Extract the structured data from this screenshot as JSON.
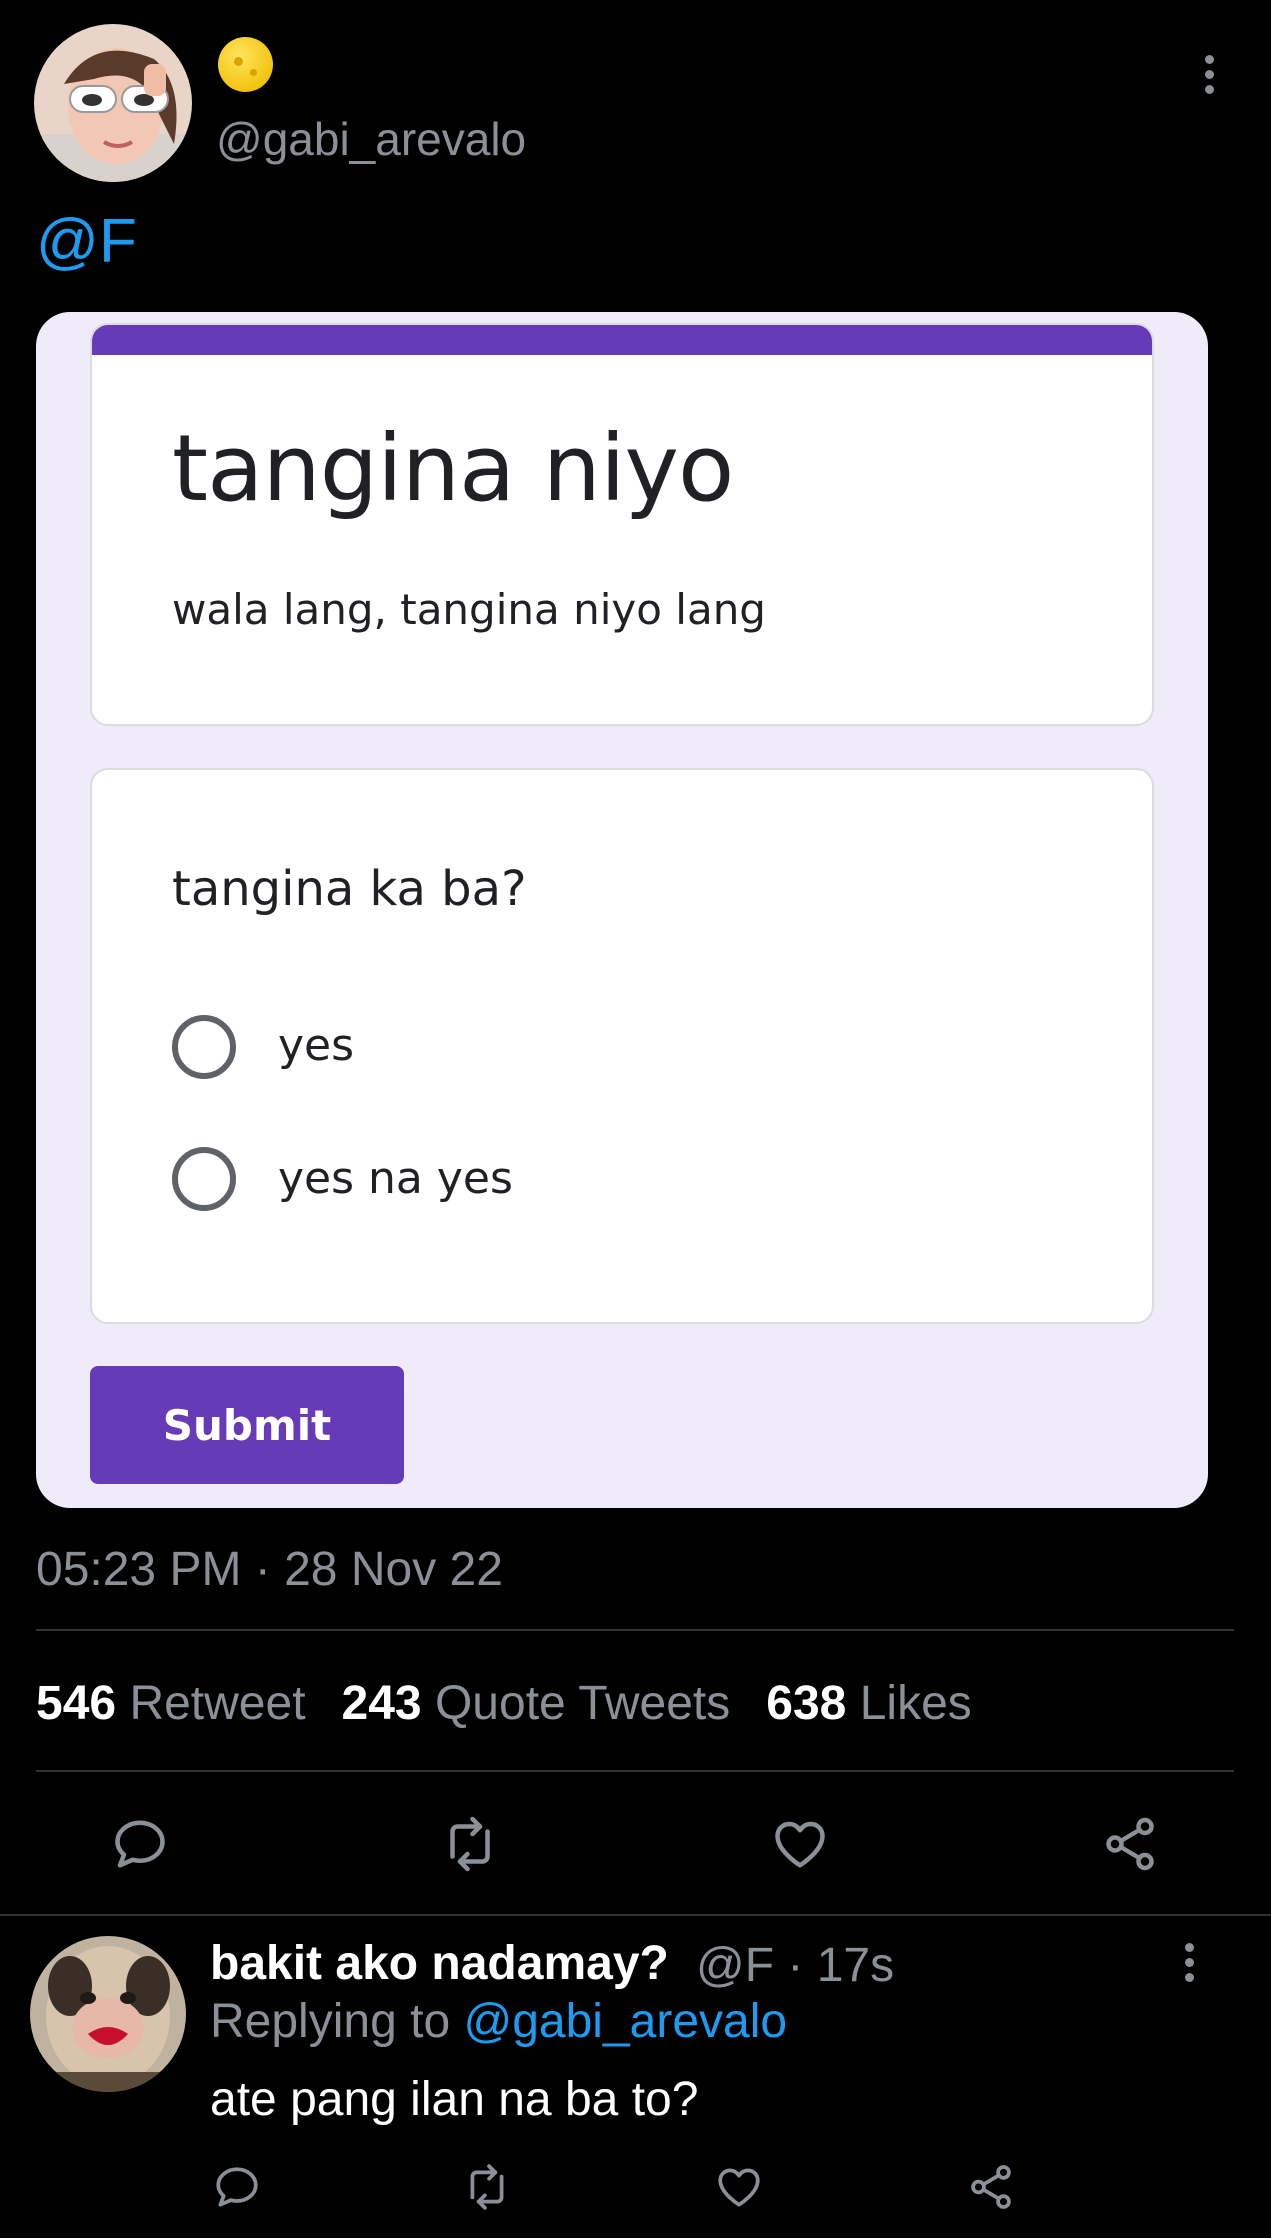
{
  "tweet": {
    "handle": "@gabi_arevalo",
    "status_emoji": "crescent-moon-emoji",
    "mention": "@F",
    "timestamp": "05:23 PM · 28 Nov 22",
    "stats": {
      "retweets_count": "546",
      "retweets_label": "Retweet",
      "quotes_count": "243",
      "quotes_label": "Quote Tweets",
      "likes_count": "638",
      "likes_label": "Likes"
    }
  },
  "form": {
    "accent_color": "#673ab7",
    "title": "tangina niyo",
    "description": "wala lang, tangina niyo lang",
    "question": "tangina ka ba?",
    "options": [
      "yes",
      "yes na yes"
    ],
    "submit_label": "Submit"
  },
  "reply": {
    "display_name": "bakit ako nadamay?",
    "handle": "@F",
    "separator": "·",
    "time_ago": "17s",
    "replying_to_label": "Replying to",
    "replying_to_handle": "@gabi_arevalo",
    "text": "ate pang ilan na ba to?"
  },
  "icons": {
    "reply": "comment-icon",
    "retweet": "retweet-icon",
    "like": "heart-icon",
    "share": "share-icon",
    "more": "more-vertical-icon"
  },
  "colors": {
    "background": "#000000",
    "link": "#1d9bf0",
    "muted": "#8b8f96"
  }
}
